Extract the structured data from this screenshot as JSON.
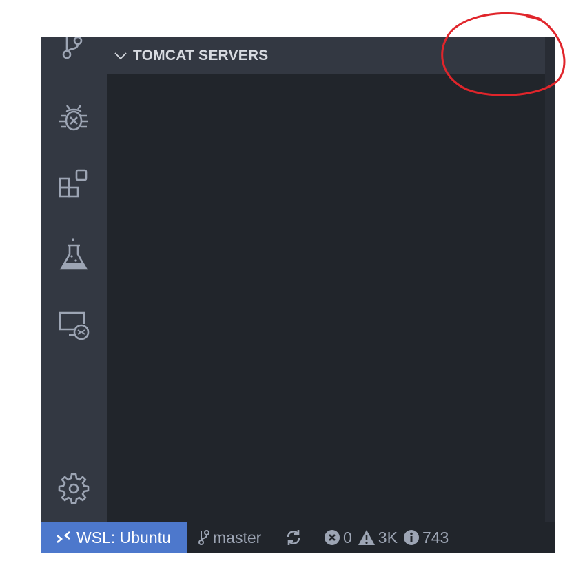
{
  "activity_bar": {
    "items": [
      {
        "icon": "source-control-icon"
      },
      {
        "icon": "debug-icon"
      },
      {
        "icon": "extensions-icon"
      },
      {
        "icon": "testing-icon"
      },
      {
        "icon": "remote-explorer-icon"
      }
    ],
    "manage": {
      "icon": "gear-icon"
    }
  },
  "sidebar": {
    "panel_title": "TOMCAT SERVERS"
  },
  "statusbar": {
    "remote_label": "WSL: Ubuntu",
    "branch": "master",
    "errors": "0",
    "warnings": "3K",
    "infos": "743"
  },
  "colors": {
    "activity_bar_bg": "#333842",
    "sidebar_bg": "#21252b",
    "remote_indicator_bg": "#4d78cc",
    "annotation_stroke": "#e0252b"
  }
}
